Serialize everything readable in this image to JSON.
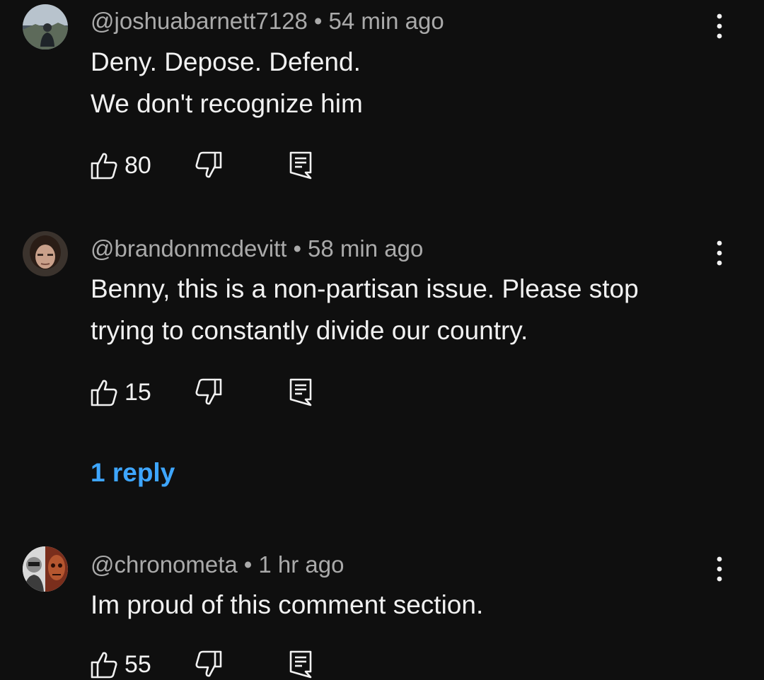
{
  "comments": [
    {
      "handle": "@joshuabarnett7128",
      "separator": "•",
      "time": "54 min ago",
      "lines": [
        "Deny. Depose. Defend.",
        "We don't recognize him"
      ],
      "likes": "80"
    },
    {
      "handle": "@brandonmcdevitt",
      "separator": "•",
      "time": "58 min ago",
      "lines": [
        "Benny, this is a non-partisan issue. Please stop",
        "trying to constantly divide our country."
      ],
      "likes": "15",
      "replies_label": "1 reply"
    },
    {
      "handle": "@chronometa",
      "separator": "•",
      "time": "1 hr ago",
      "lines": [
        "Im proud of this comment section."
      ],
      "likes": "55"
    }
  ],
  "icons": {
    "like": "thumbs-up-icon",
    "dislike": "thumbs-down-icon",
    "reply": "reply-icon",
    "menu": "more-vert-icon"
  },
  "colors": {
    "background": "#0f0f0f",
    "text": "#f1f1f1",
    "meta": "#aaaaaa",
    "link": "#3ea6ff"
  }
}
